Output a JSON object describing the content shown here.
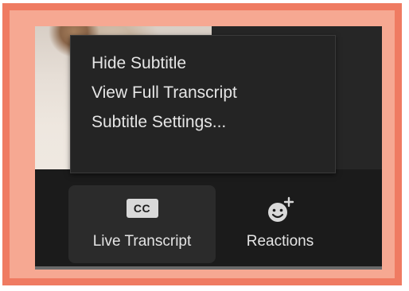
{
  "context_menu": {
    "items": [
      {
        "label": "Hide Subtitle"
      },
      {
        "label": "View Full Transcript"
      },
      {
        "label": "Subtitle Settings..."
      }
    ]
  },
  "toolbar": {
    "live_transcript": {
      "icon_text": "CC",
      "label": "Live Transcript",
      "icon": "closed-captions-icon"
    },
    "reactions": {
      "label": "Reactions",
      "icon": "smiley-plus-icon"
    }
  },
  "colors": {
    "frame_border": "#ef7b62",
    "frame_fill": "#f6a892",
    "menu_background": "#242424",
    "toolbar_background": "#1b1b1b"
  }
}
